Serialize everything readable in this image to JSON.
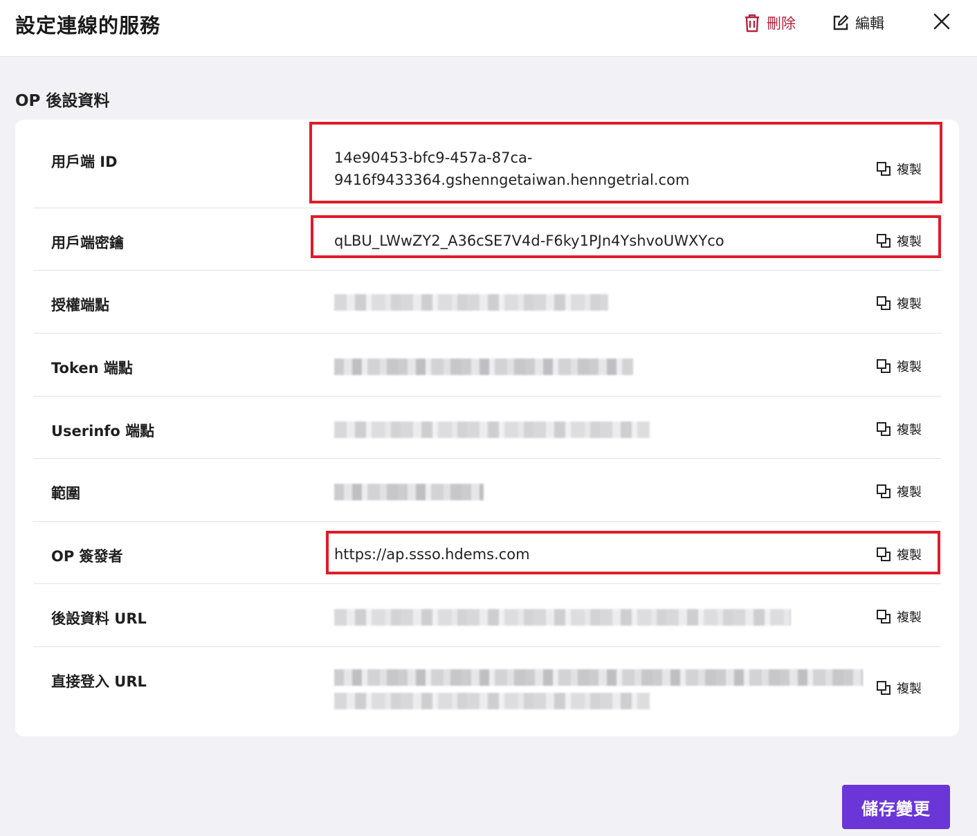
{
  "header": {
    "title": "設定連線的服務",
    "delete_label": "刪除",
    "edit_label": "編輯",
    "delete_color": "#b3243c"
  },
  "section_title": "OP 後設資料",
  "copy_label": "複製",
  "rows": [
    {
      "label": "用戶端 ID",
      "value_line1": "14e90453-bfc9-457a-87ca-",
      "value_line2": "9416f9433364.gshenngetaiwan.henngetrial.com"
    },
    {
      "label": "用戶端密鑰",
      "value": "qLBU_LWwZY2_A36cSE7V4d-F6ky1PJn4YshvoUWXYco"
    },
    {
      "label": "授權端點",
      "value": ""
    },
    {
      "label": "Token 端點",
      "value": ""
    },
    {
      "label": "Userinfo 端點",
      "value": ""
    },
    {
      "label": "範圍",
      "value": ""
    },
    {
      "label": "OP 簽發者",
      "value": "https://ap.ssso.hdems.com"
    },
    {
      "label": "後設資料 URL",
      "value": ""
    },
    {
      "label": "直接登入 URL",
      "value": ""
    }
  ],
  "save_label": "儲存變更",
  "accent_color": "#6a36d8",
  "highlight_color": "#e01b2a"
}
